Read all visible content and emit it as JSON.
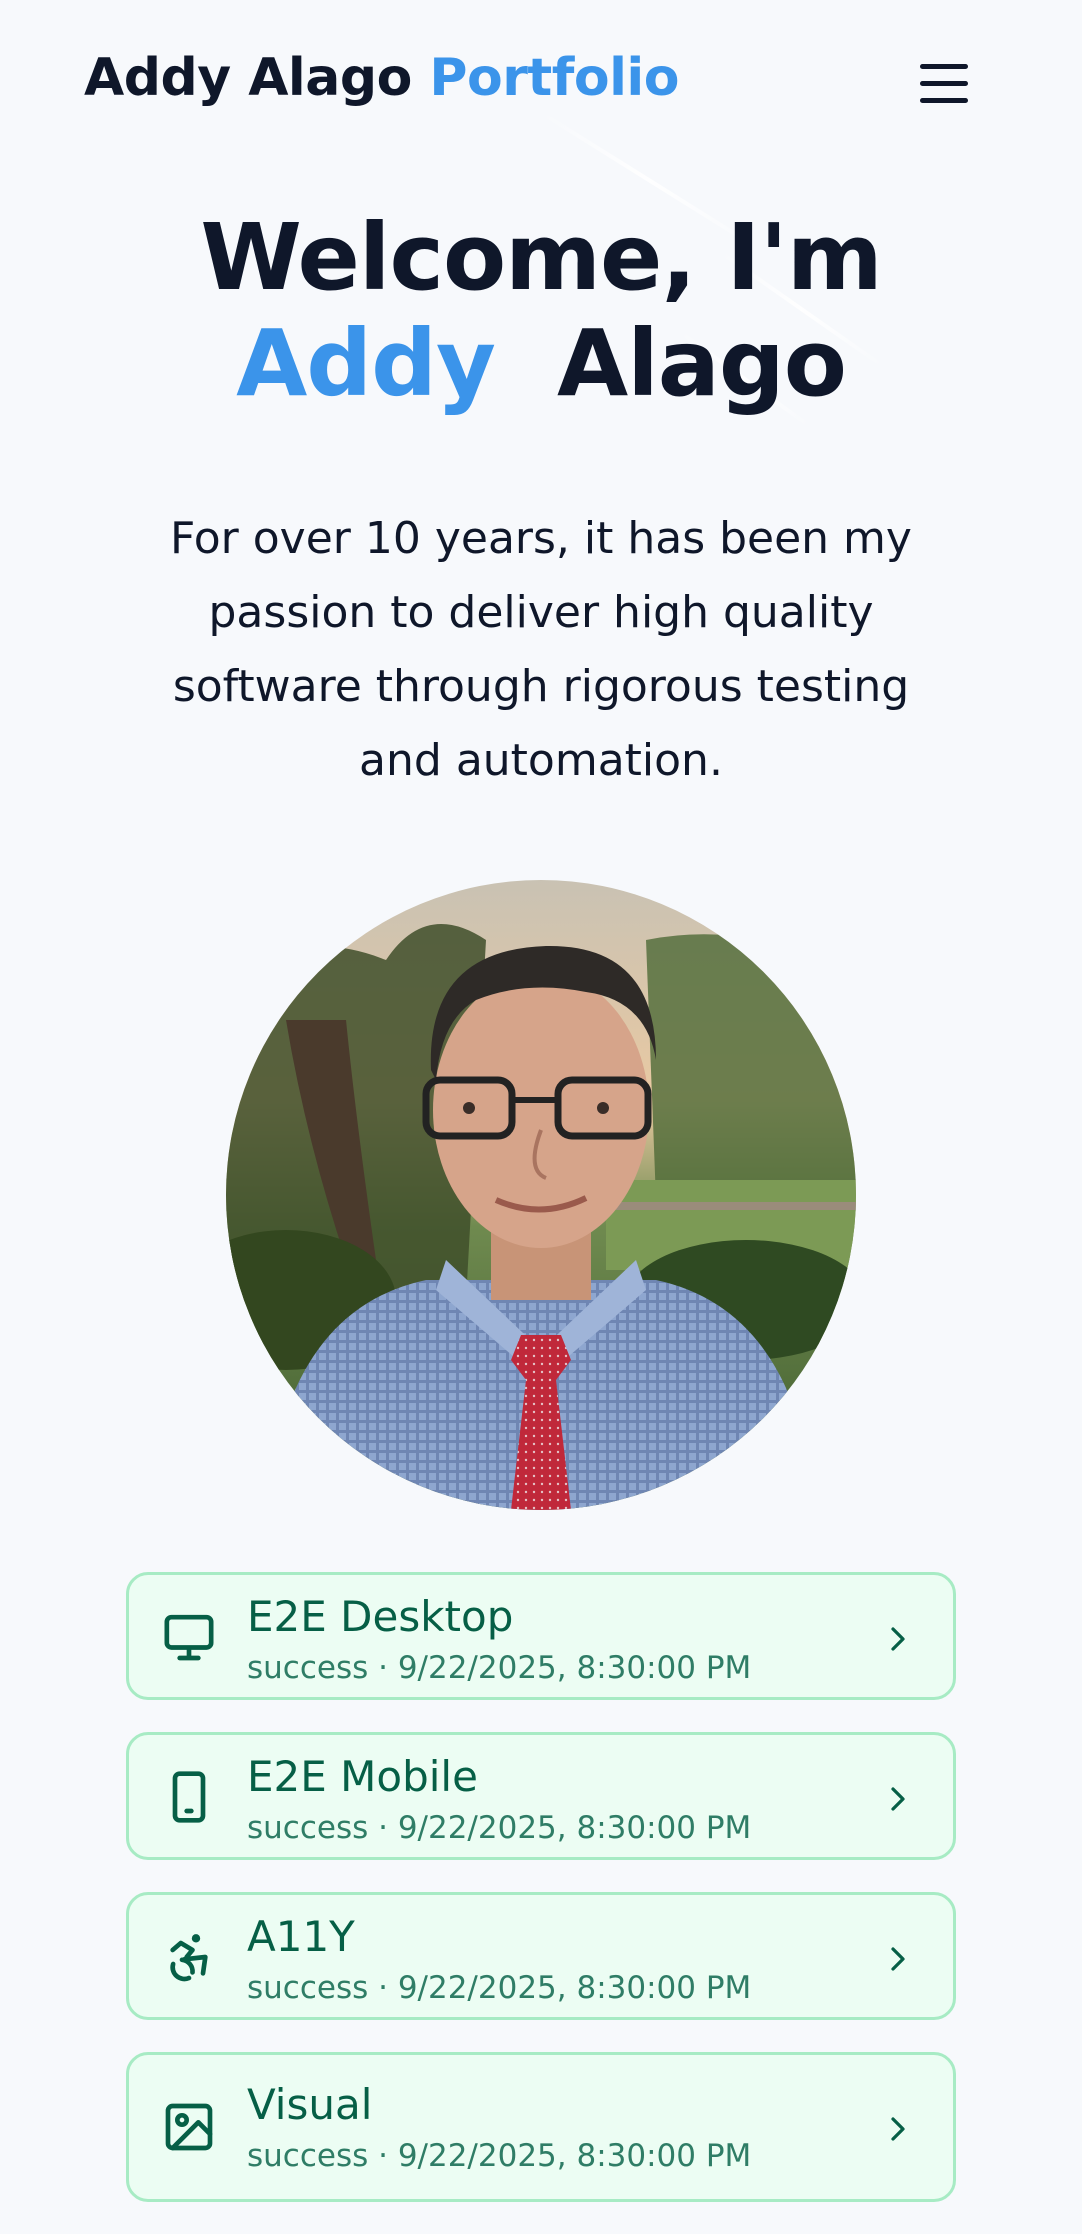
{
  "header": {
    "brand_name": "Addy Alago",
    "brand_accent": "Portfolio",
    "menu_icon": "hamburger-menu-icon"
  },
  "hero": {
    "title_line1": "Welcome, I'm",
    "title_first": "Addy",
    "title_last": "Alago",
    "intro": "For over 10 years, it has been my passion to deliver high quality software through rigorous testing and automation."
  },
  "profile_photo": {
    "subject": "portrait-photo"
  },
  "test_runs": [
    {
      "title": "E2E Desktop",
      "status": "success",
      "timestamp": "9/22/2025, 8:30:00 PM",
      "meta": "success · 9/22/2025, 8:30:00 PM",
      "icon": "monitor-icon"
    },
    {
      "title": "E2E Mobile",
      "status": "success",
      "timestamp": "9/22/2025, 8:30:00 PM",
      "meta": "success · 9/22/2025, 8:30:00 PM",
      "icon": "smartphone-icon"
    },
    {
      "title": "A11Y",
      "status": "success",
      "timestamp": "9/22/2025, 8:30:00 PM",
      "meta": "success · 9/22/2025, 8:30:00 PM",
      "icon": "accessibility-icon"
    },
    {
      "title": "Visual",
      "status": "success",
      "timestamp": "9/22/2025, 8:30:00 PM",
      "meta": "success · 9/22/2025, 8:30:00 PM",
      "icon": "image-icon"
    }
  ],
  "colors": {
    "accent": "#3b94ea",
    "text": "#0f172a",
    "background": "#f7f9fc",
    "success_bg": "#ecfdf3",
    "success_border": "#a7ebc4",
    "success_text": "#065f46"
  }
}
